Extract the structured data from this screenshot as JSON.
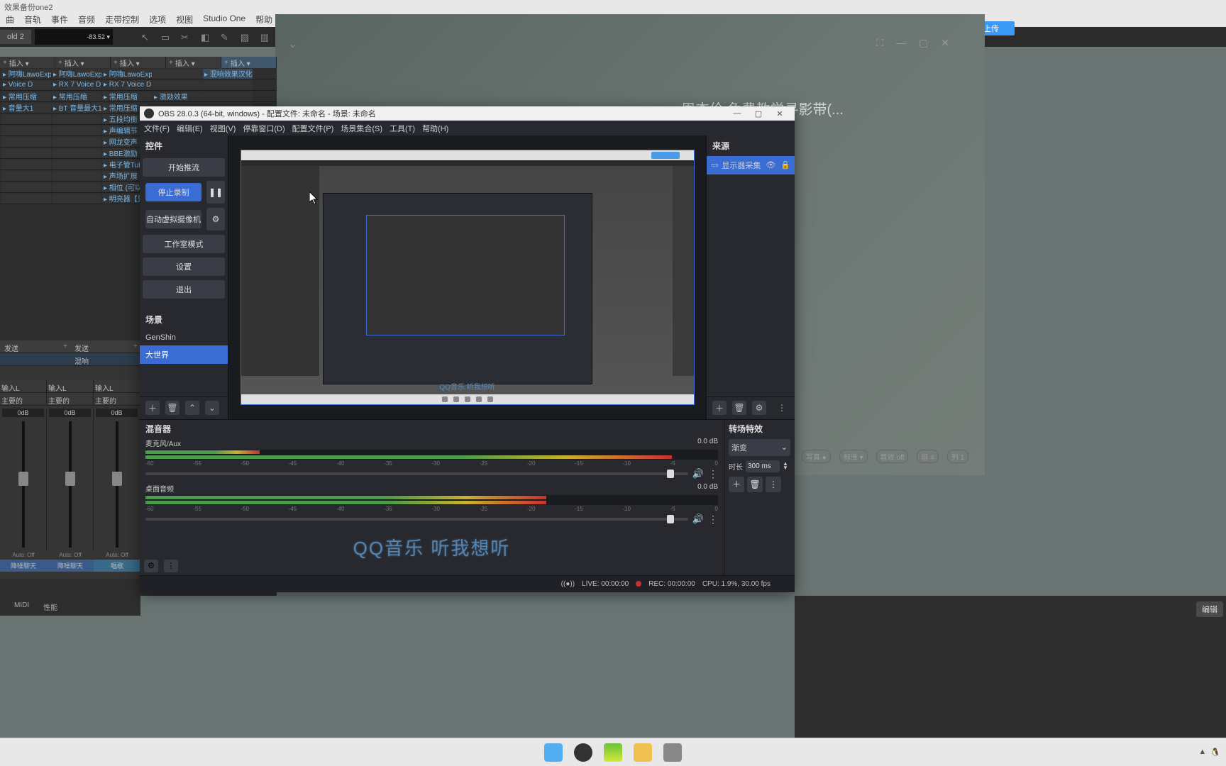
{
  "background": {
    "title": "效果备份one2",
    "menus": [
      "曲",
      "音轨",
      "事件",
      "音频",
      "走带控制",
      "选项",
      "视图",
      "Studio One",
      "帮助"
    ],
    "toolbar_tab": "old 2",
    "toolbar_meter": "-83.52 ▾",
    "track_headers": [
      "插入 ▾",
      "插入 ▾",
      "插入 ▾",
      "插入 ▾",
      "插入 ▾"
    ],
    "track_rows": [
      [
        "阿嗨LawoExp",
        "阿嗨LawoExp",
        "阿嗨LawoExp",
        "",
        "混响效果汉化"
      ],
      [
        "Voice D",
        "RX 7 Voice D",
        "RX 7 Voice D",
        "",
        ""
      ],
      [
        "常用压缩",
        "常用压缩",
        "常用压缩",
        "激励效果",
        ""
      ],
      [
        "音量大1",
        "BT 音量最大1",
        "常用压缩",
        "",
        ""
      ],
      [
        "",
        "",
        "五段均衡",
        "",
        ""
      ],
      [
        "",
        "",
        "声编辑节",
        "",
        ""
      ],
      [
        "",
        "",
        "网龙变声",
        "",
        ""
      ],
      [
        "",
        "",
        "BBE激励",
        "",
        ""
      ],
      [
        "",
        "",
        "电子管TubeV",
        "",
        ""
      ],
      [
        "",
        "",
        "声场扩展",
        "",
        ""
      ],
      [
        "",
        "",
        "相位 (可以)",
        "",
        ""
      ],
      [
        "",
        "",
        "明亮器【兄】",
        "",
        ""
      ]
    ],
    "mixer": {
      "send": "发送",
      "send2": "发送",
      "mix_item": "混响",
      "input_row": [
        "输入L",
        "输入L",
        "输入L"
      ],
      "main_row": [
        "主要的",
        "主要的",
        "主要的"
      ],
      "db_labels": [
        "0dB",
        "0dB",
        "0dB"
      ],
      "auto": "Auto: Off",
      "bottom_labels": [
        "降噪聊天",
        "降噪聊天",
        "唱歌"
      ],
      "midi": "MIDI",
      "perf": "性能"
    },
    "edit_btn": "编辑"
  },
  "cloud": {
    "upload_label": "拖拽上传"
  },
  "music": {
    "title": "周杰伦 免费教学寻影带(...",
    "ctrls": [
      "写真 ●",
      "标准 ▾",
      "音效 off",
      "倍 ≡",
      "列 1"
    ]
  },
  "obs": {
    "title": "OBS 28.0.3 (64-bit, windows) - 配置文件: 未命名 - 场景: 未命名",
    "menus": [
      "文件(F)",
      "编辑(E)",
      "视图(V)",
      "停靠窗口(D)",
      "配置文件(P)",
      "场景集合(S)",
      "工具(T)",
      "帮助(H)"
    ],
    "controls": {
      "title": "控件",
      "start_stream": "开始推流",
      "stop_record": "停止录制",
      "virtual_cam": "自动虚拟摄像机",
      "studio_mode": "工作室模式",
      "settings": "设置",
      "exit": "退出"
    },
    "scenes": {
      "title": "场景",
      "items": [
        "GenShin",
        "大世界"
      ],
      "active": 1
    },
    "sources": {
      "title": "来源",
      "items": [
        {
          "label": "显示器采集"
        }
      ]
    },
    "mixer": {
      "title": "混音器",
      "channels": [
        {
          "name": "麦克风/Aux",
          "db": "0.0 dB",
          "fill_a": 20,
          "fill_b": 92
        },
        {
          "name": "桌面音频",
          "db": "0.0 dB",
          "fill_a": 70,
          "fill_b": 70
        }
      ],
      "scale": [
        "-60",
        "-55",
        "-50",
        "-45",
        "-40",
        "-35",
        "-30",
        "-25",
        "-20",
        "-15",
        "-10",
        "-5",
        "0"
      ]
    },
    "transitions": {
      "title": "转场特效",
      "type": "渐变",
      "duration_label": "时长",
      "duration": "300 ms"
    },
    "status": {
      "live": "LIVE: 00:00:00",
      "rec": "REC: 00:00:00",
      "cpu": "CPU: 1.9%, 30.00 fps"
    },
    "preview_text": "QQ音乐 听我想听"
  },
  "subtitle": "QQ音乐 听我想听",
  "taskbar_tray": [
    "▲",
    "🐧"
  ]
}
